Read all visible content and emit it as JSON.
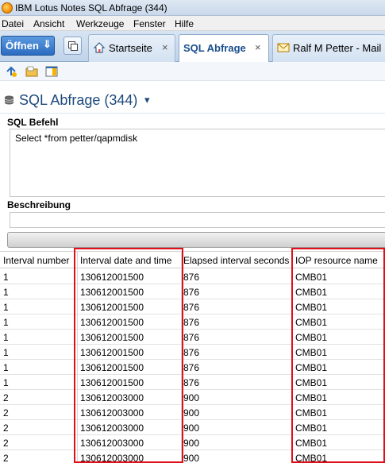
{
  "window": {
    "title": "IBM Lotus Notes SQL Abfrage (344)"
  },
  "menu": [
    "Datei",
    "Ansicht",
    "Werkzeuge",
    "Fenster",
    "Hilfe"
  ],
  "tabbar": {
    "open_label": "Öffnen",
    "tabs": [
      {
        "label": "Startseite",
        "close": "×"
      },
      {
        "label": "SQL Abfrage",
        "close": "×"
      },
      {
        "label": "Ralf M Petter - Mail"
      }
    ]
  },
  "view": {
    "title": "SQL Abfrage (344)",
    "dropdown_icon": "▾"
  },
  "sql": {
    "label": "SQL Befehl",
    "value": "Select *from petter/qapmdisk"
  },
  "description": {
    "label": "Beschreibung",
    "value": ""
  },
  "results": {
    "columns": [
      "Interval number",
      "Interval date and time",
      "Elapsed interval seconds",
      "IOP resource name"
    ],
    "rows": [
      [
        "1",
        "130612001500",
        "876",
        "CMB01"
      ],
      [
        "1",
        "130612001500",
        "876",
        "CMB01"
      ],
      [
        "1",
        "130612001500",
        "876",
        "CMB01"
      ],
      [
        "1",
        "130612001500",
        "876",
        "CMB01"
      ],
      [
        "1",
        "130612001500",
        "876",
        "CMB01"
      ],
      [
        "1",
        "130612001500",
        "876",
        "CMB01"
      ],
      [
        "1",
        "130612001500",
        "876",
        "CMB01"
      ],
      [
        "1",
        "130612001500",
        "876",
        "CMB01"
      ],
      [
        "2",
        "130612003000",
        "900",
        "CMB01"
      ],
      [
        "2",
        "130612003000",
        "900",
        "CMB01"
      ],
      [
        "2",
        "130612003000",
        "900",
        "CMB01"
      ],
      [
        "2",
        "130612003000",
        "900",
        "CMB01"
      ],
      [
        "2",
        "130612003000",
        "900",
        "CMB01"
      ]
    ]
  },
  "colors": {
    "highlight": "#e0101a",
    "title_blue": "#1d4a7c"
  }
}
